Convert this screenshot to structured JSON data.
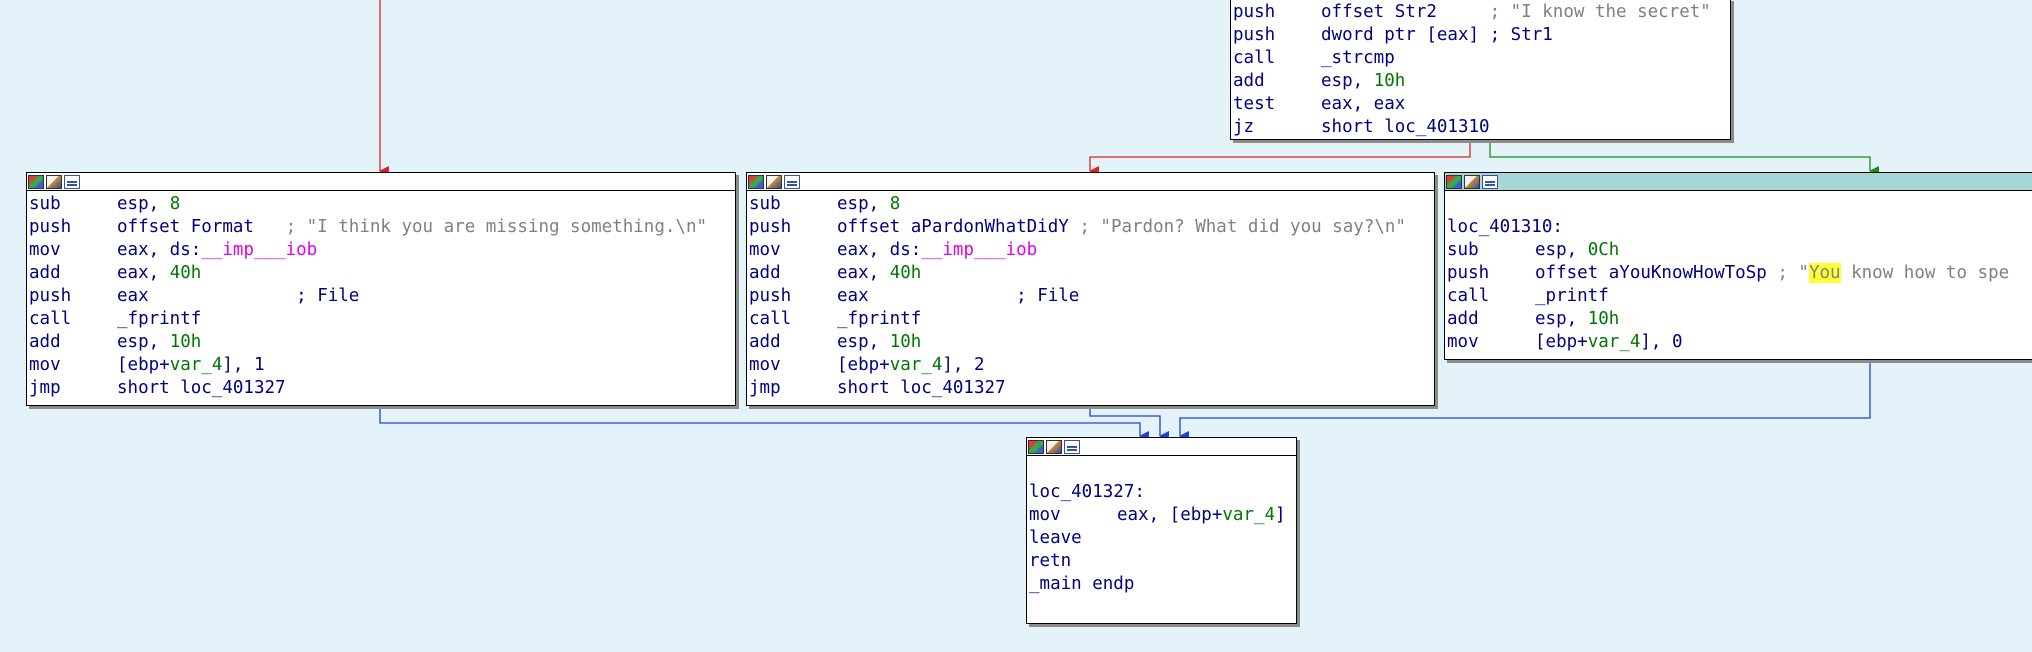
{
  "graph": {
    "node_top": {
      "lines": [
        {
          "mnemonic": "push",
          "operand": "offset Str2",
          "comment": "; \"I know the secret\""
        },
        {
          "mnemonic": "push",
          "operand": "dword ptr [eax]",
          "comment": "; Str1"
        },
        {
          "mnemonic": "call",
          "operand": "_strcmp"
        },
        {
          "mnemonic": "add",
          "operand": "esp, ",
          "num": "10h"
        },
        {
          "mnemonic": "test",
          "operand": "eax, eax"
        },
        {
          "mnemonic": "jz",
          "operand": "short loc_401310"
        }
      ]
    },
    "node_left": {
      "lines": [
        {
          "mnemonic": "sub",
          "operand": "esp, ",
          "num": "8"
        },
        {
          "mnemonic": "push",
          "operand": "offset Format",
          "comment": "; \"I think you are missing something.\\n\""
        },
        {
          "mnemonic": "mov",
          "operand": "eax, ds:",
          "imp": "__imp___iob"
        },
        {
          "mnemonic": "add",
          "operand": "eax, ",
          "num": "40h"
        },
        {
          "mnemonic": "push",
          "operand": "eax",
          "comment": "; File"
        },
        {
          "mnemonic": "call",
          "operand": "_fprintf"
        },
        {
          "mnemonic": "add",
          "operand": "esp, ",
          "num": "10h"
        },
        {
          "mnemonic": "mov",
          "operand": "[ebp+",
          "var": "var_4",
          "tail": "], 1"
        },
        {
          "mnemonic": "jmp",
          "operand": "short loc_401327"
        }
      ]
    },
    "node_mid": {
      "lines": [
        {
          "mnemonic": "sub",
          "operand": "esp, ",
          "num": "8"
        },
        {
          "mnemonic": "push",
          "operand": "offset aPardonWhatDidY",
          "comment": "; \"Pardon? What did you say?\\n\""
        },
        {
          "mnemonic": "mov",
          "operand": "eax, ds:",
          "imp": "__imp___iob"
        },
        {
          "mnemonic": "add",
          "operand": "eax, ",
          "num": "40h"
        },
        {
          "mnemonic": "push",
          "operand": "eax",
          "comment": "; File"
        },
        {
          "mnemonic": "call",
          "operand": "_fprintf"
        },
        {
          "mnemonic": "add",
          "operand": "esp, ",
          "num": "10h"
        },
        {
          "mnemonic": "mov",
          "operand": "[ebp+",
          "var": "var_4",
          "tail": "], 2"
        },
        {
          "mnemonic": "jmp",
          "operand": "short loc_401327"
        }
      ]
    },
    "node_right": {
      "label": "loc_401310:",
      "lines": [
        {
          "mnemonic": "sub",
          "operand": "esp, ",
          "num": "0Ch"
        },
        {
          "mnemonic": "push",
          "operand": "offset aYouKnowHowToSp",
          "comment_pre": "; \"",
          "comment_hl": "You",
          "comment": " know how to spe"
        },
        {
          "mnemonic": "call",
          "operand": "_printf"
        },
        {
          "mnemonic": "add",
          "operand": "esp, ",
          "num": "10h"
        },
        {
          "mnemonic": "mov",
          "operand": "[ebp+",
          "var": "var_4",
          "tail": "], 0"
        }
      ]
    },
    "node_bottom": {
      "label": "loc_401327:",
      "lines": [
        {
          "mnemonic": "mov",
          "operand": "eax, [ebp+",
          "var": "var_4",
          "tail": "]"
        },
        {
          "mnemonic": "leave"
        },
        {
          "mnemonic": "retn"
        }
      ],
      "endp": "_main endp"
    }
  },
  "colors": {
    "background": "#e4f3fa",
    "edge_false": "#e02020",
    "edge_true": "#1a8c1a",
    "edge_flow": "#2040e0",
    "node_header_highlight": "#a6d6d6",
    "search_highlight": "#ffff33"
  },
  "icons": [
    "graph-overview-icon",
    "edit-node-icon",
    "node-listing-icon"
  ]
}
